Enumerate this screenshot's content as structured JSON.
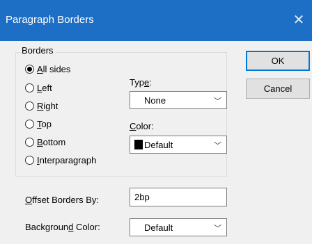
{
  "window": {
    "title": "Paragraph Borders"
  },
  "borders": {
    "group_label": "Borders",
    "options": [
      {
        "pre": "",
        "u": "A",
        "post": "ll sides",
        "checked": true
      },
      {
        "pre": "",
        "u": "L",
        "post": "eft",
        "checked": false
      },
      {
        "pre": "",
        "u": "R",
        "post": "ight",
        "checked": false
      },
      {
        "pre": "",
        "u": "T",
        "post": "op",
        "checked": false
      },
      {
        "pre": "",
        "u": "B",
        "post": "ottom",
        "checked": false
      },
      {
        "pre": "",
        "u": "I",
        "post": "nterparagraph",
        "checked": false
      }
    ]
  },
  "type_field": {
    "pre": "Typ",
    "u": "e",
    "post": ":",
    "value": "None"
  },
  "color_field": {
    "pre": "",
    "u": "C",
    "post": "olor:",
    "value": "Default",
    "swatch": "#000000"
  },
  "offset_field": {
    "pre": "",
    "u": "O",
    "post": "ffset Borders By:",
    "value": "2bp"
  },
  "background_field": {
    "pre": "Backgroun",
    "u": "d",
    "post": " Color:",
    "value": "Default"
  },
  "buttons": {
    "ok": "OK",
    "cancel": "Cancel"
  }
}
